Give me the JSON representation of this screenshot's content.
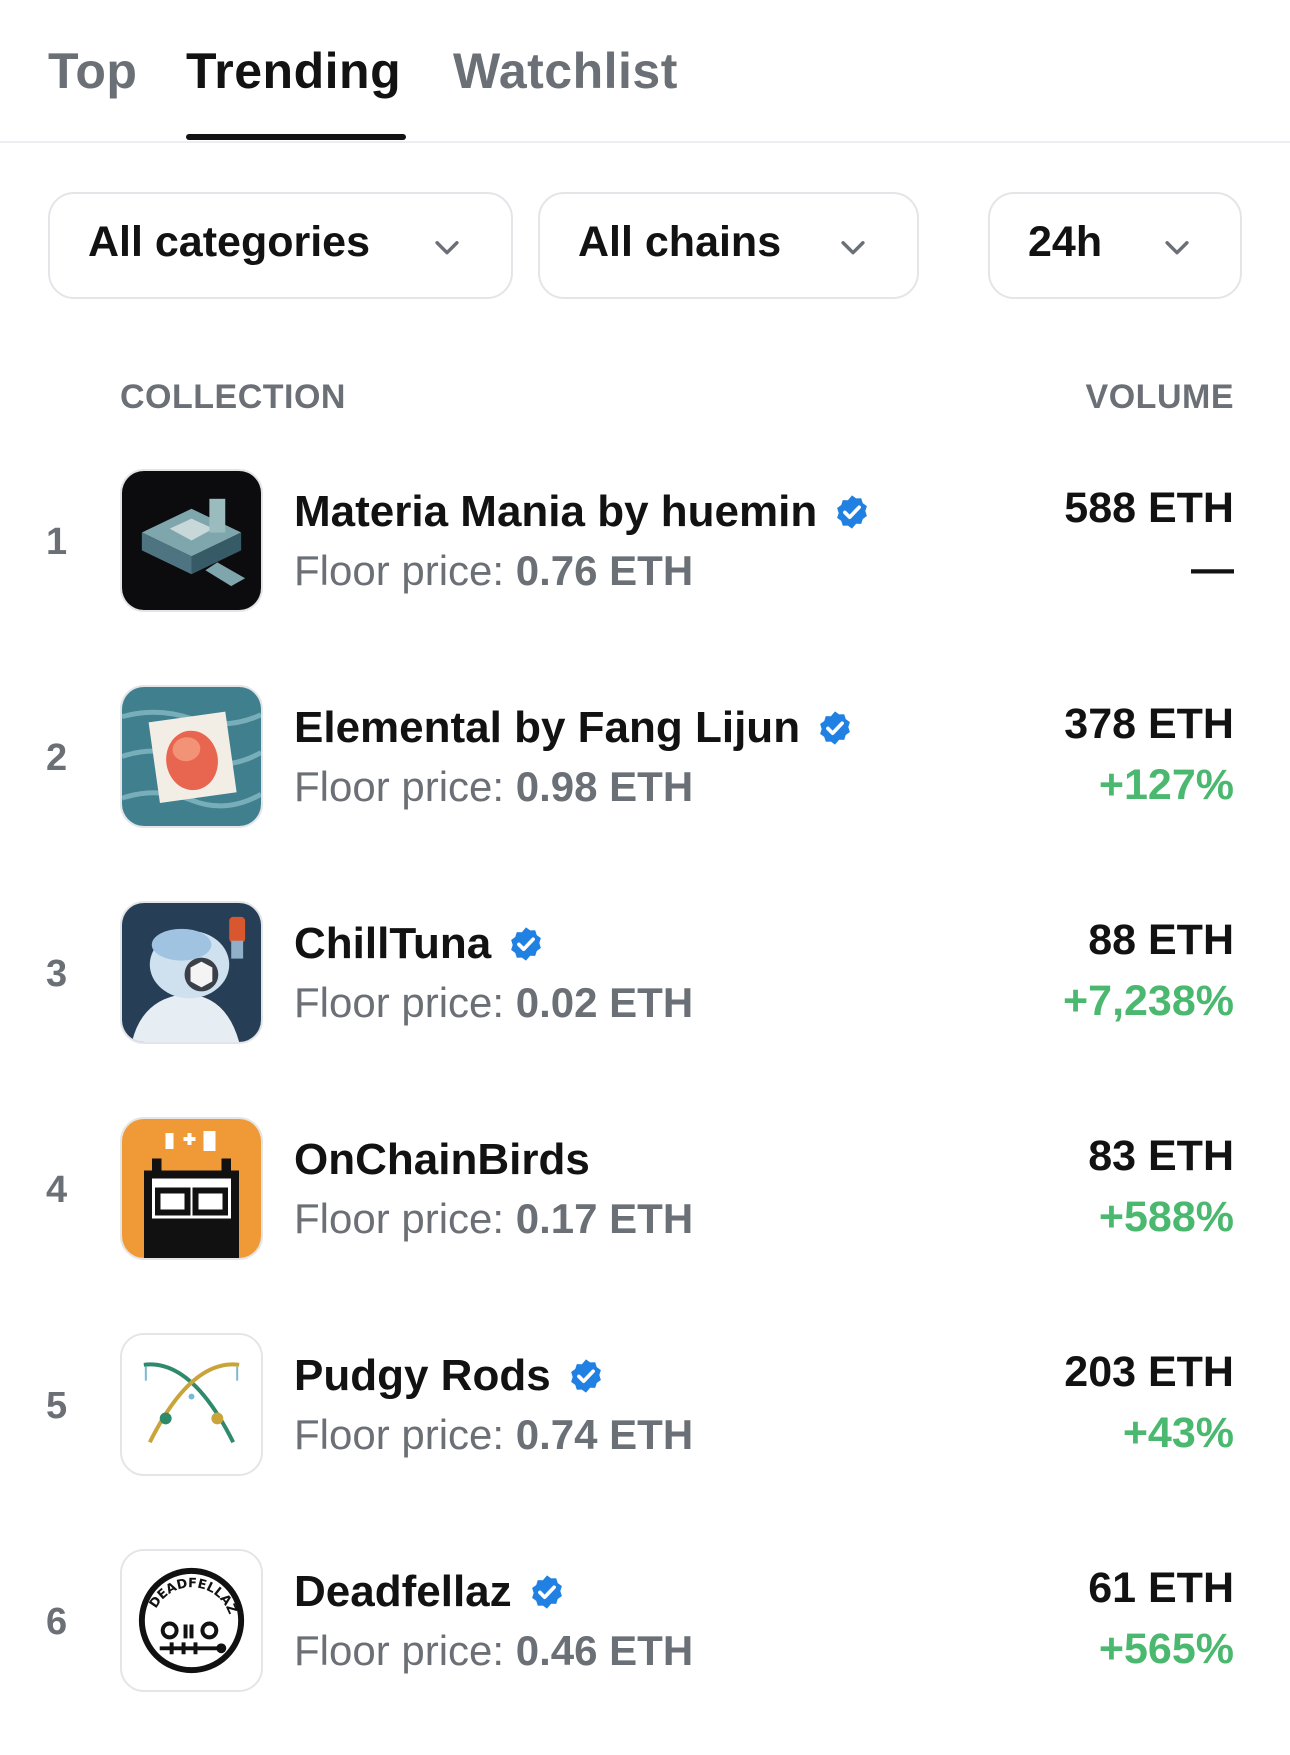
{
  "tabs": [
    {
      "label": "Top",
      "active": false
    },
    {
      "label": "Trending",
      "active": true
    },
    {
      "label": "Watchlist",
      "active": false
    }
  ],
  "filters": {
    "category": {
      "selected": "All categories",
      "icon": "chevron-down-icon"
    },
    "chain": {
      "selected": "All chains",
      "icon": "chevron-down-icon"
    },
    "period": {
      "selected": "24h",
      "icon": "chevron-down-icon"
    }
  },
  "table": {
    "headers": {
      "collection": "COLLECTION",
      "volume": "VOLUME"
    },
    "floor_prefix": "Floor price: ",
    "rows": [
      {
        "rank": "1",
        "name": "Materia Mania by huemin",
        "verified": true,
        "floor": "0.76 ETH",
        "volume": "588 ETH",
        "change": "—",
        "change_state": "flat",
        "image": "materia-mania-thumbnail"
      },
      {
        "rank": "2",
        "name": "Elemental by Fang Lijun",
        "verified": true,
        "floor": "0.98 ETH",
        "volume": "378 ETH",
        "change": "+127%",
        "change_state": "positive",
        "image": "elemental-thumbnail"
      },
      {
        "rank": "3",
        "name": "ChillTuna",
        "verified": true,
        "floor": "0.02 ETH",
        "volume": "88 ETH",
        "change": "+7,238%",
        "change_state": "positive",
        "image": "chilltuna-thumbnail"
      },
      {
        "rank": "4",
        "name": "OnChainBirds",
        "verified": false,
        "floor": "0.17 ETH",
        "volume": "83 ETH",
        "change": "+588%",
        "change_state": "positive",
        "image": "onchainbirds-thumbnail"
      },
      {
        "rank": "5",
        "name": "Pudgy Rods",
        "verified": true,
        "floor": "0.74 ETH",
        "volume": "203 ETH",
        "change": "+43%",
        "change_state": "positive",
        "image": "pudgy-rods-thumbnail"
      },
      {
        "rank": "6",
        "name": "Deadfellaz",
        "verified": true,
        "floor": "0.46 ETH",
        "volume": "61 ETH",
        "change": "+565%",
        "change_state": "positive",
        "image": "deadfellaz-thumbnail",
        "logo_text": "DEADFELLAZ"
      }
    ]
  },
  "colors": {
    "text": "#121212",
    "muted": "#6b6f76",
    "positive": "#4bb86f",
    "verified": "#2081e2",
    "border": "#e3e5e8"
  }
}
